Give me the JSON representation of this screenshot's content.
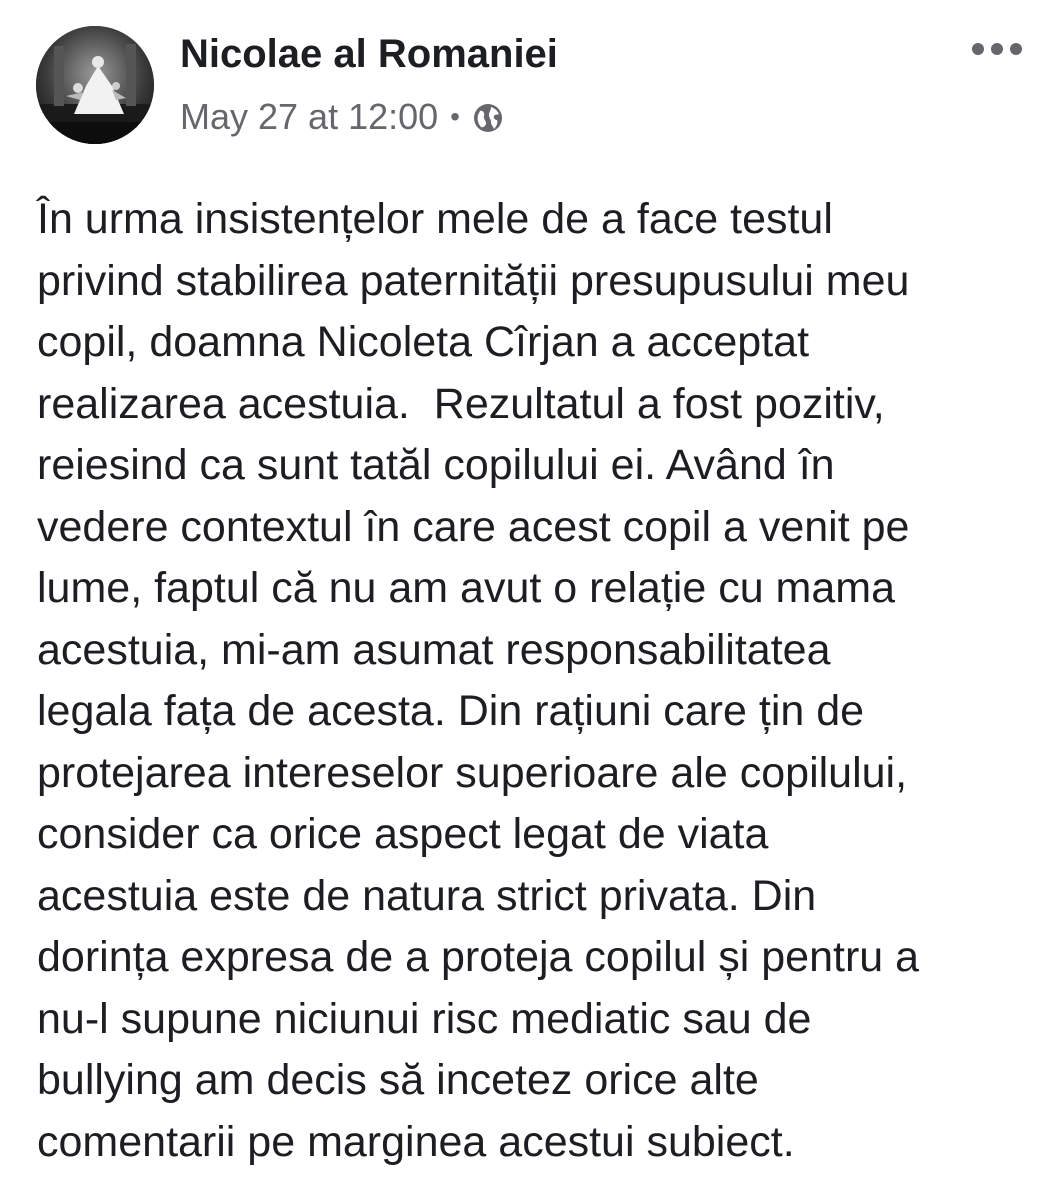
{
  "post": {
    "author": "Nicolae al Romaniei",
    "timestamp": "May 27 at 12:00",
    "separator": "•",
    "privacy_icon": "globe-icon",
    "more_icon": "more-options-icon",
    "body_lines": [
      "În urma insistențelor mele de a face testul",
      "privind stabilirea paternității presupusului meu",
      "copil, doamna Nicoleta Cîrjan a acceptat",
      "realizarea acestuia.  Rezultatul a fost pozitiv,",
      "reiesind ca sunt tatăl copilului ei. Având în",
      "vedere contextul în care acest copil a venit pe",
      "lume, faptul că nu am avut o relație cu mama",
      "acestuia, mi-am asumat responsabilitatea",
      "legala fața de acesta. Din rațiuni care țin de",
      "protejarea intereselor superioare ale copilului,",
      "consider ca orice aspect legat de viata",
      "acestuia este de natura strict privata. Din",
      "dorința expresa de a proteja copilul și pentru a",
      "nu-l supune niciunui risc mediatic sau de",
      "bullying am decis să incetez orice alte",
      "comentarii pe marginea acestui subiect."
    ]
  },
  "colors": {
    "text_primary": "#1c1e21",
    "text_secondary": "#65676b",
    "background": "#ffffff"
  }
}
